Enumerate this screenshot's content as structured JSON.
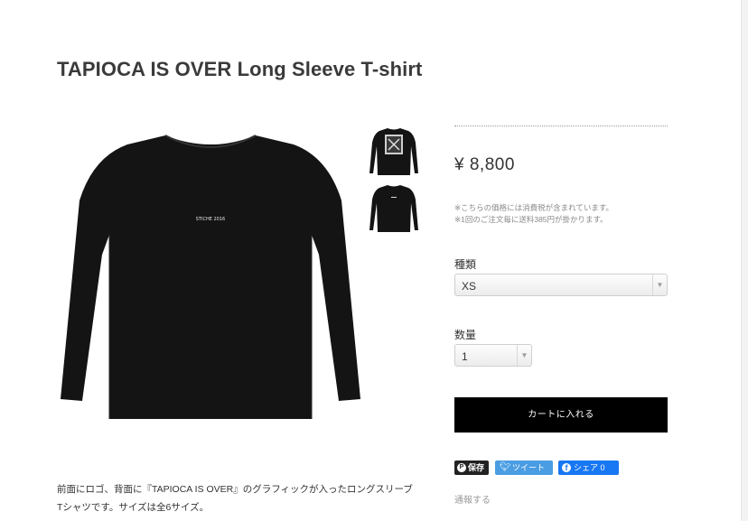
{
  "product": {
    "title": "TAPIOCA IS OVER Long Sleeve T-shirt",
    "price": "¥ 8,800",
    "tax_note_1": "※こちらの価格には消費税が含まれています。",
    "tax_note_2": "※1回のご注文毎に送料385円が掛かります。",
    "description_line_1": "前面にロゴ、背面に『TAPIOCA IS OVER』のグラフィックが入ったロングスリーブ",
    "description_line_2": "Tシャツです。サイズは全6サイズ。",
    "front_print_text": "STICHE 2016",
    "back_print_text": "TAPIOCA IS OVER"
  },
  "options": {
    "type_label": "種類",
    "type_value": "XS",
    "quantity_label": "数量",
    "quantity_value": "1"
  },
  "actions": {
    "add_to_cart": "カートに入れる",
    "report": "通報する"
  },
  "share": {
    "pinterest": "保存",
    "twitter": "ツイート",
    "facebook": "シェア 0"
  },
  "icons": {
    "pinterest": "pinterest-icon",
    "twitter": "twitter-bird-icon",
    "facebook": "facebook-icon",
    "dropdown": "chevron-down-icon"
  },
  "colors": {
    "cart_button": "#000000",
    "twitter": "#4a9de3",
    "facebook": "#1877f2",
    "pinterest": "#222222",
    "shirt": "#141414"
  }
}
